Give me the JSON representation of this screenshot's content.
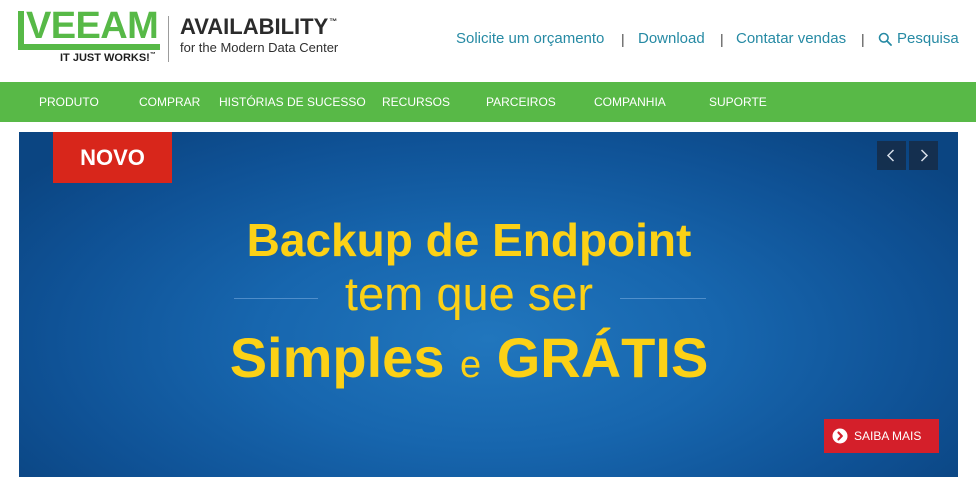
{
  "header": {
    "logo": {
      "wordmark": "VEEAM",
      "tagline": "IT JUST WORKS!",
      "tagline_tm": "™"
    },
    "brand": {
      "title": "AVAILABILITY",
      "title_tm": "™",
      "subtitle": "for the Modern Data Center"
    },
    "links": {
      "quote": "Solicite um orçamento",
      "download": "Download",
      "contact_sales": "Contatar vendas",
      "search": "Pesquisa"
    },
    "separator": "|"
  },
  "nav": {
    "items": [
      "PRODUTO",
      "COMPRAR",
      "HISTÓRIAS DE SUCESSO",
      "RECURSOS",
      "PARCEIROS",
      "COMPANHIA",
      "SUPORTE"
    ]
  },
  "banner": {
    "badge": "NOVO",
    "line1": "Backup de Endpoint",
    "line2": "tem que ser",
    "line3": {
      "word1": "Simples",
      "connector": "e",
      "word2": "GRÁTIS"
    },
    "cta": {
      "label": "SAIBA MAIS"
    }
  },
  "icons": {
    "search": "search-icon",
    "prev": "chevron-left-icon",
    "next": "chevron-right-icon",
    "cta": "arrow-circle-right-icon"
  },
  "colors": {
    "brand_green": "#58b947",
    "link_teal": "#268aa4",
    "badge_red": "#d8261b",
    "cta_red": "#d41f2a",
    "headline_yellow": "#fcd116",
    "banner_blue": "#1766ae"
  }
}
